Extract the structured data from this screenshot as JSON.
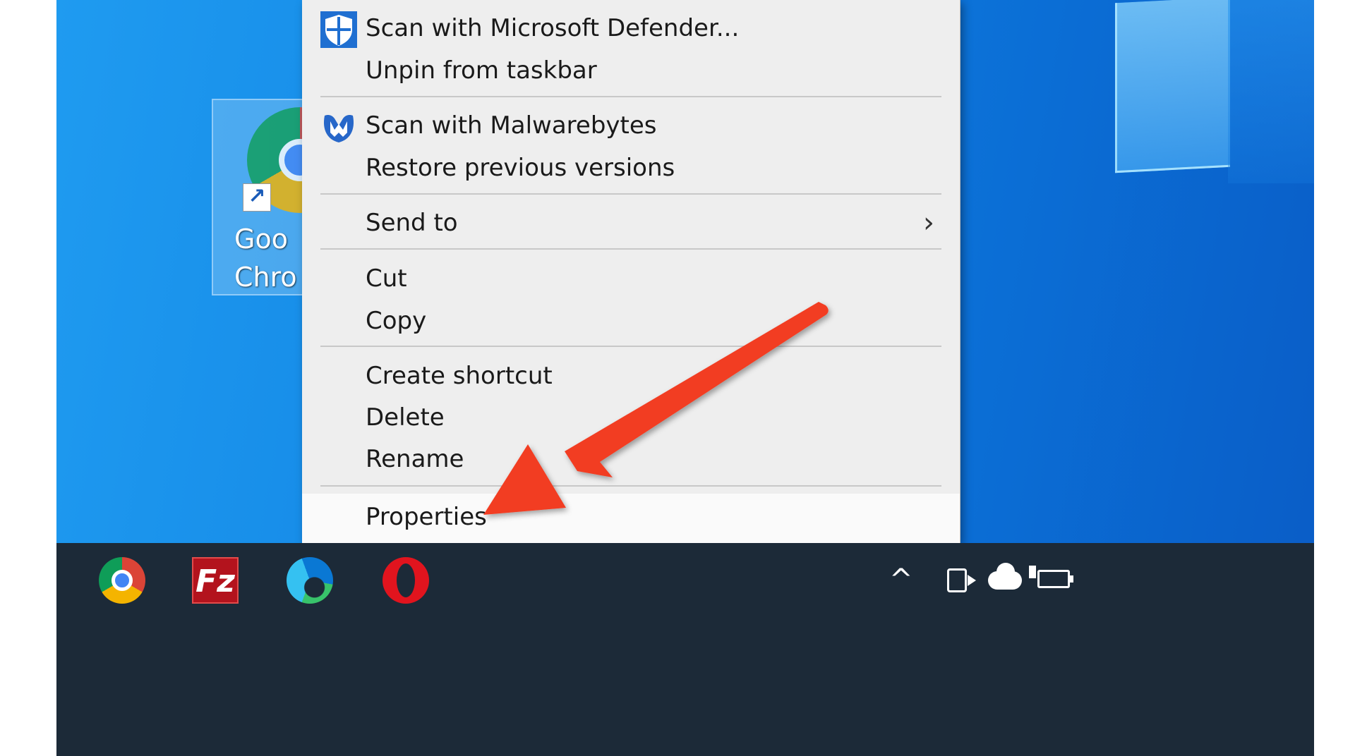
{
  "desktop": {
    "icon_label": "Goo\nChro"
  },
  "context_menu": {
    "items": [
      {
        "label": "Scan with Microsoft Defender...",
        "icon": "defender-shield-icon"
      },
      {
        "label": "Unpin from taskbar"
      },
      {
        "label": "Scan with Malwarebytes",
        "icon": "malwarebytes-icon"
      },
      {
        "label": "Restore previous versions"
      },
      {
        "label": "Send to",
        "icon": "chevron-right-icon"
      },
      {
        "label": "Cut"
      },
      {
        "label": "Copy"
      },
      {
        "label": "Create shortcut"
      },
      {
        "label": "Delete"
      },
      {
        "label": "Rename"
      },
      {
        "label": "Properties",
        "state": "highlighted"
      }
    ],
    "send_to_chevron": "›"
  },
  "taskbar": {
    "apps": [
      "chrome-icon",
      "filezilla-icon",
      "edge-icon",
      "opera-icon"
    ],
    "filezilla_glyph": "Fz",
    "tray_up": "^",
    "tray_icons": [
      "meet-now-icon",
      "onedrive-cloud-icon",
      "battery-charging-icon"
    ]
  },
  "colors": {
    "desktop_blue": "#1488e6",
    "menu_bg": "#eeeeee",
    "taskbar_bg": "#1c2a38",
    "annotation_arrow": "#f23c22"
  }
}
